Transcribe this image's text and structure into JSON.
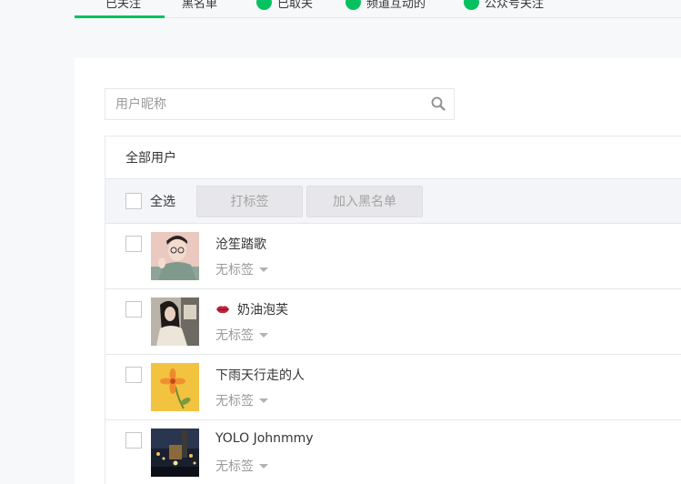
{
  "tabs": [
    {
      "label": "已关注",
      "active": true,
      "has_dot": false
    },
    {
      "label": "黑名单",
      "active": false,
      "has_dot": false
    },
    {
      "label": "已取关",
      "active": false,
      "has_dot": true
    },
    {
      "label": "频道互动的",
      "active": false,
      "has_dot": true
    },
    {
      "label": "公众号关注",
      "active": false,
      "has_dot": true
    }
  ],
  "search": {
    "placeholder": "用户昵称",
    "value": ""
  },
  "list": {
    "header": "全部用户",
    "select_all_label": "全选",
    "tag_button": "打标签",
    "blacklist_button": "加入黑名单",
    "users": [
      {
        "nickname": "沧笙踏歌",
        "tag": "无标签",
        "avatar": "young man with glasses illustration"
      },
      {
        "nickname": "奶油泡芙",
        "tag": "无标签",
        "avatar": "woman photo",
        "prefix_icon": "lips-icon"
      },
      {
        "nickname": "下雨天行走的人",
        "tag": "无标签",
        "avatar": "orange flower on yellow"
      },
      {
        "nickname": "YOLO Johnmmy",
        "tag": "无标签",
        "avatar": "city night lights"
      }
    ]
  },
  "colors": {
    "accent": "#07c160",
    "border": "#e4e8eb",
    "page_bg": "#f6f8f9"
  }
}
